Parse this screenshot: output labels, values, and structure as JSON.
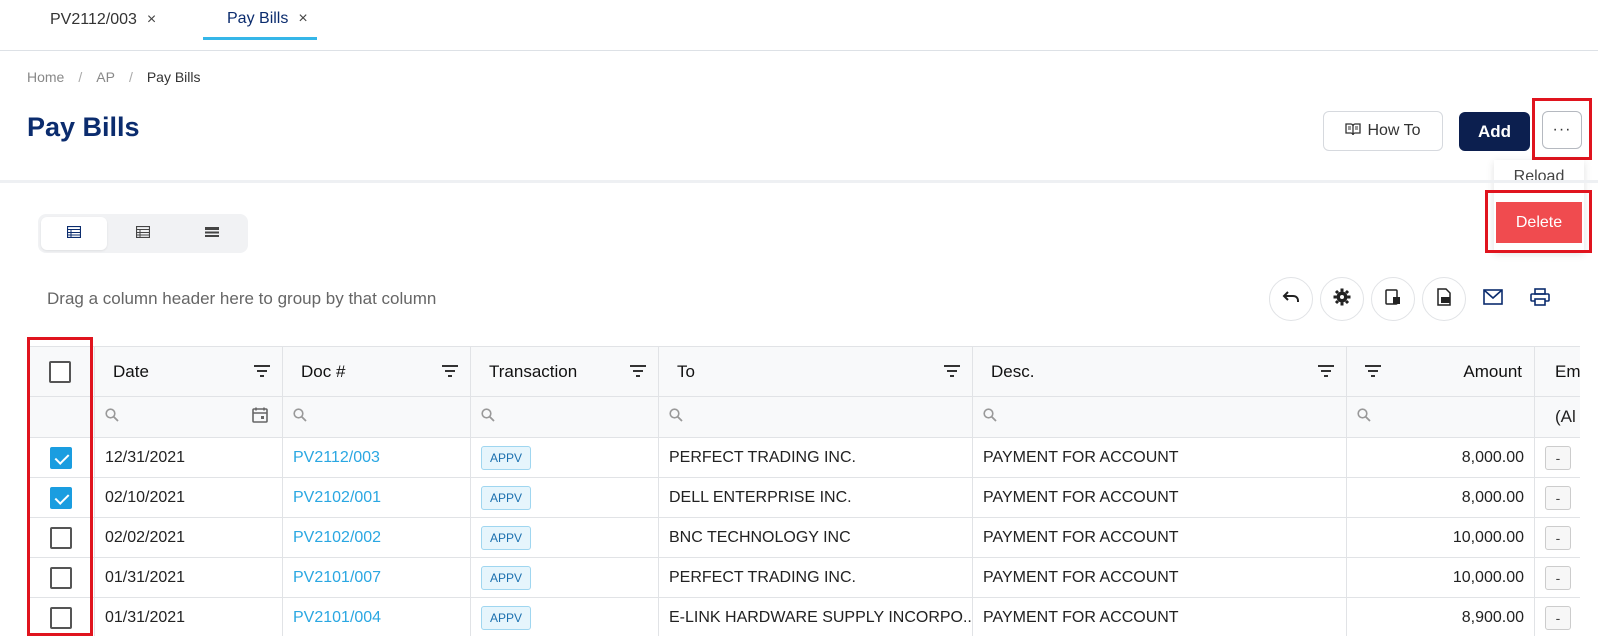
{
  "tabs": [
    {
      "label": "PV2112/003",
      "active": false
    },
    {
      "label": "Pay Bills",
      "active": true
    }
  ],
  "close_glyph": "×",
  "breadcrumb": {
    "home": "Home",
    "ap": "AP",
    "current": "Pay Bills",
    "separator": "/"
  },
  "page_title": "Pay Bills",
  "actions": {
    "how_to": "How To",
    "add": "Add",
    "more": "···"
  },
  "dropdown": {
    "reload": "Reload",
    "delete": "Delete"
  },
  "group_hint": "Drag a column header here to group by that column",
  "columns": {
    "date": "Date",
    "doc": "Doc #",
    "transaction": "Transaction",
    "to": "To",
    "desc": "Desc.",
    "amount": "Amount",
    "em": "Em"
  },
  "filter": {
    "em_value": "(Al"
  },
  "rows": [
    {
      "checked": true,
      "date": "12/31/2021",
      "doc": "PV2112/003",
      "transaction": "APPV",
      "to": "PERFECT TRADING INC.",
      "desc": "PAYMENT FOR ACCOUNT",
      "amount": "8,000.00",
      "em": "-"
    },
    {
      "checked": true,
      "date": "02/10/2021",
      "doc": "PV2102/001",
      "transaction": "APPV",
      "to": "DELL ENTERPRISE INC.",
      "desc": "PAYMENT FOR ACCOUNT",
      "amount": "8,000.00",
      "em": "-"
    },
    {
      "checked": false,
      "date": "02/02/2021",
      "doc": "PV2102/002",
      "transaction": "APPV",
      "to": "BNC TECHNOLOGY INC",
      "desc": "PAYMENT FOR ACCOUNT",
      "amount": "10,000.00",
      "em": "-"
    },
    {
      "checked": false,
      "date": "01/31/2021",
      "doc": "PV2101/007",
      "transaction": "APPV",
      "to": "PERFECT TRADING INC.",
      "desc": "PAYMENT FOR ACCOUNT",
      "amount": "10,000.00",
      "em": "-"
    },
    {
      "checked": false,
      "date": "01/31/2021",
      "doc": "PV2101/004",
      "transaction": "APPV",
      "to": "E-LINK HARDWARE SUPPLY INCORPO...",
      "desc": "PAYMENT FOR ACCOUNT",
      "amount": "8,900.00",
      "em": "-"
    }
  ],
  "colors": {
    "primary": "#0c1f4f",
    "accent": "#35b6e8",
    "link": "#2aa7e2",
    "danger": "#f04b4f",
    "highlight": "#e0141e"
  }
}
